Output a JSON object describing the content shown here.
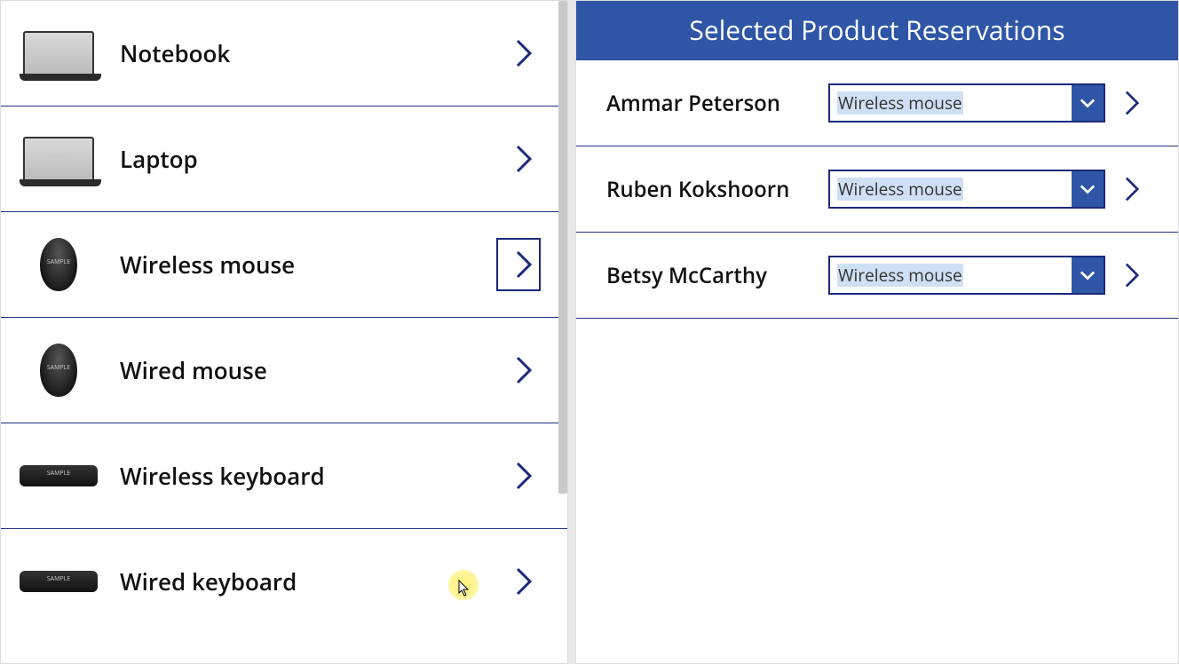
{
  "colors": {
    "accent": "#2f56a6",
    "border": "#24317e"
  },
  "products": [
    {
      "name": "Notebook",
      "thumb": "laptop",
      "selected": false
    },
    {
      "name": "Laptop",
      "thumb": "laptop",
      "selected": false
    },
    {
      "name": "Wireless mouse",
      "thumb": "mouse",
      "selected": true
    },
    {
      "name": "Wired mouse",
      "thumb": "mouse",
      "selected": false
    },
    {
      "name": "Wireless keyboard",
      "thumb": "keyboard",
      "selected": false
    },
    {
      "name": "Wired keyboard",
      "thumb": "keyboard",
      "selected": false
    }
  ],
  "right": {
    "header": "Selected Product Reservations",
    "reservations": [
      {
        "name": "Ammar Peterson",
        "product": "Wireless mouse"
      },
      {
        "name": "Ruben Kokshoorn",
        "product": "Wireless mouse"
      },
      {
        "name": "Betsy McCarthy",
        "product": "Wireless mouse"
      }
    ]
  }
}
